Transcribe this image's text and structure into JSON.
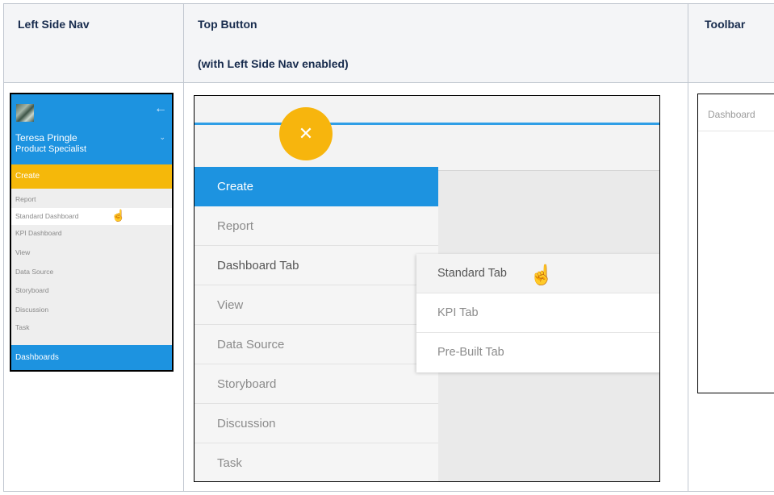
{
  "table": {
    "headers": {
      "col1": "Left Side Nav",
      "col2_line1": "Top Button",
      "col2_line2": "(with Left Side Nav enabled)",
      "col3": "Toolbar"
    }
  },
  "left_side_nav": {
    "user_name": "Teresa Pringle",
    "user_role": "Product Specialist",
    "create_label": "Create",
    "items": [
      "Report",
      "Standard Dashboard",
      "KPI Dashboard",
      "View",
      "Data Source",
      "Storyboard",
      "Discussion",
      "Task"
    ],
    "dashboards_label": "Dashboards",
    "back_icon": "←",
    "chevron_icon": "⌄",
    "cursor_icon": "☝"
  },
  "top_button": {
    "fab_icon": "✕",
    "menu": [
      "Create",
      "Report",
      "Dashboard Tab",
      "View",
      "Data Source",
      "Storyboard",
      "Discussion",
      "Task"
    ],
    "submenu": [
      "Standard Tab",
      "KPI Tab",
      "Pre-Built Tab"
    ],
    "cursor_icon": "☝"
  },
  "toolbar": {
    "label": "Dashboard"
  },
  "colors": {
    "accent_blue": "#1d93e0",
    "accent_yellow": "#f5b80a",
    "header_bg": "#f4f5f7",
    "border": "#c1c7d0"
  }
}
